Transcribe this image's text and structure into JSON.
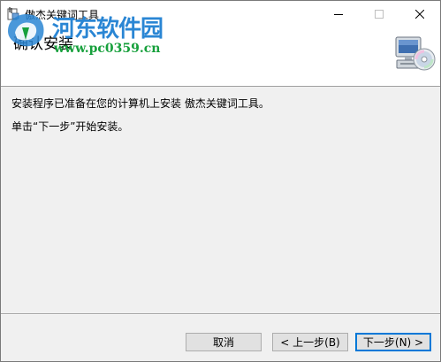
{
  "window": {
    "title": "傲杰关键词工具",
    "icon": "installer-icon",
    "controls": {
      "minimize": "minimize-icon",
      "maximize": "maximize-icon",
      "close": "close-icon"
    }
  },
  "banner": {
    "title": "确认安装",
    "icon": "computer-disc-icon"
  },
  "watermark": {
    "name": "河东软件园",
    "url": "www.pc0359.cn"
  },
  "content": {
    "line1": "安装程序已准备在您的计算机上安装 傲杰关键词工具。",
    "line2": "单击“下一步”开始安装。"
  },
  "buttons": {
    "cancel": "取消",
    "back": "< 上一步(B)",
    "next": "下一步(N) >"
  },
  "colors": {
    "accent": "#0078d7",
    "watermark_blue": "#2a86d4",
    "watermark_green": "#17a03c"
  }
}
